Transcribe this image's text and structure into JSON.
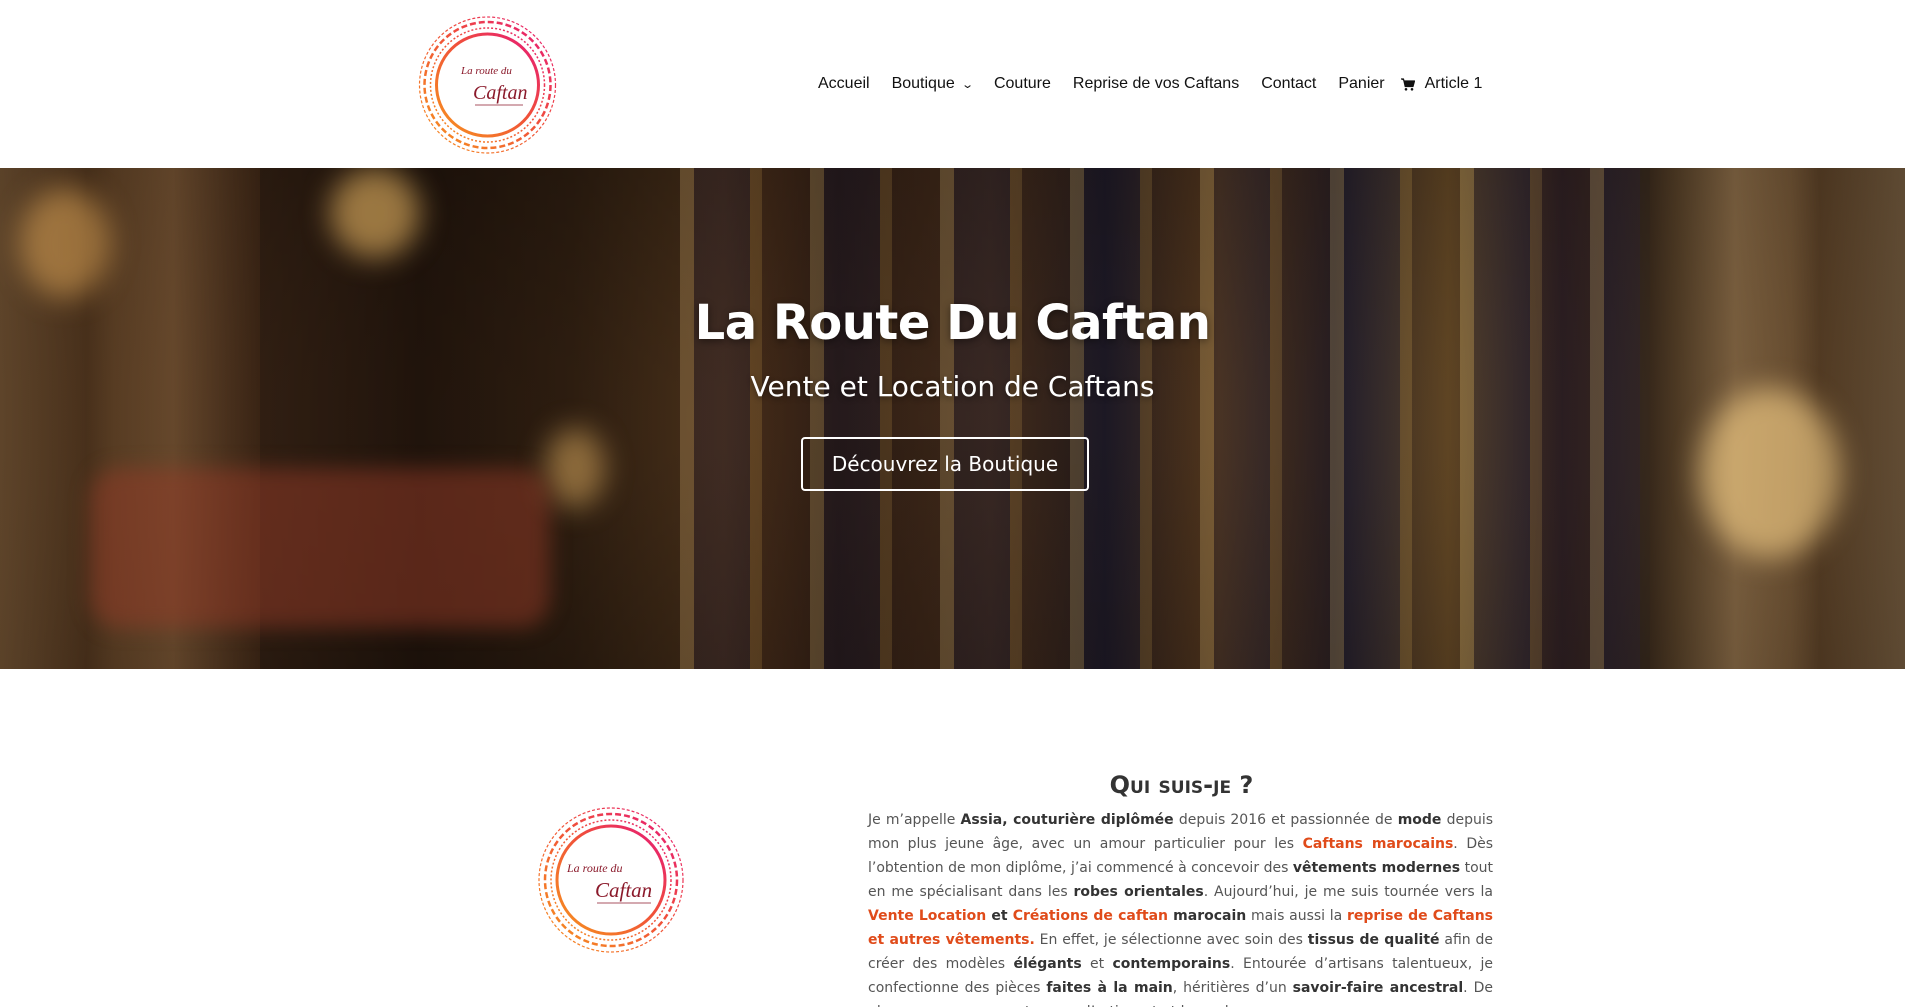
{
  "header": {
    "logo": {
      "line1": "La route du",
      "line2": "Caftan"
    },
    "nav": [
      {
        "label": "Accueil"
      },
      {
        "label": "Boutique"
      },
      {
        "label": "Couture"
      },
      {
        "label": "Reprise de vos Caftans"
      },
      {
        "label": "Contact"
      },
      {
        "label": "Panier"
      }
    ],
    "cart_label": "Article 1"
  },
  "hero": {
    "title": "La Route Du Caftan",
    "subtitle": "Vente et Location de Caftans",
    "button_label": "Découvrez la Boutique"
  },
  "about": {
    "title": "Qui suis-je ?",
    "logo": {
      "line1": "La route du",
      "line2": "Caftan"
    },
    "paragraph": [
      {
        "t": "Je m’appelle "
      },
      {
        "t": "Assia, couturière diplômée",
        "s": "b"
      },
      {
        "t": " depuis 2016 et passionnée de "
      },
      {
        "t": "mode",
        "s": "b"
      },
      {
        "t": " depuis mon plus jeune âge, avec un amour particulier pour les "
      },
      {
        "t": "Caftans marocains",
        "s": "hl"
      },
      {
        "t": ". Dès l’obtention de mon diplôme, j’ai commencé à concevoir des "
      },
      {
        "t": "vêtements modernes",
        "s": "b"
      },
      {
        "t": " tout en me spécialisant dans les "
      },
      {
        "t": "robes orientales",
        "s": "b"
      },
      {
        "t": ". Aujourd’hui, je me suis tournée vers la "
      },
      {
        "t": "Vente Location",
        "s": "hl"
      },
      {
        "t": " et ",
        "s": "b"
      },
      {
        "t": "Créations de caftan",
        "s": "hl"
      },
      {
        "t": " marocain",
        "s": "b"
      },
      {
        "t": " mais aussi la "
      },
      {
        "t": "reprise de Caftans et autres vêtements.",
        "s": "hl"
      },
      {
        "t": "  En effet, je sélectionne avec soin des "
      },
      {
        "t": "tissus de qualité",
        "s": "b"
      },
      {
        "t": " afin de créer des modèles "
      },
      {
        "t": "élégants",
        "s": "b"
      },
      {
        "t": " et "
      },
      {
        "t": "contemporains",
        "s": "b"
      },
      {
        "t": ". Entourée d’artisans talentueux, je confectionne des pièces "
      },
      {
        "t": "faites à la main",
        "s": "b"
      },
      {
        "t": ", héritières d’un "
      },
      {
        "t": "savoir-faire ancestral",
        "s": "b"
      },
      {
        "t": ". De plus, mon engagement envers l’artisanat et la mode"
      }
    ]
  },
  "colors": {
    "accent": "#e04b1a",
    "logo_gradient_start": "#f7941d",
    "logo_gradient_end": "#e6177a",
    "logo_text": "#8b1a2b"
  },
  "icons": {
    "cart": "cart-icon",
    "dropdown": "chevron-down-icon"
  }
}
